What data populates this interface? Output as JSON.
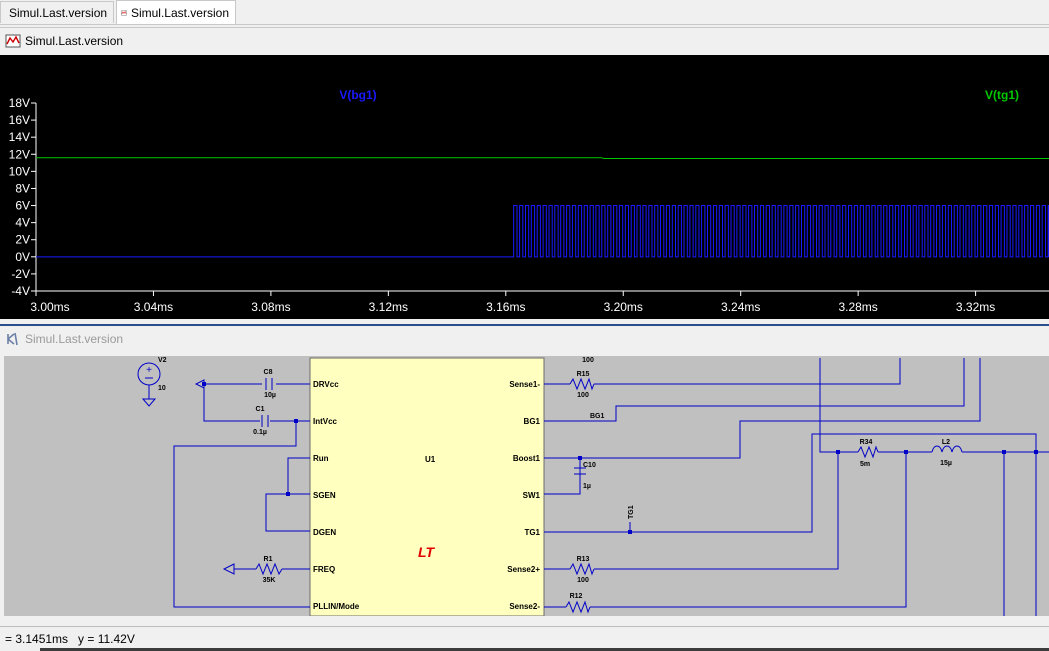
{
  "tabs": [
    {
      "label": "Simul.Last.version",
      "icon": "schematic-icon",
      "active": false
    },
    {
      "label": "Simul.Last.version",
      "icon": "waveform-icon",
      "active": true
    }
  ],
  "wave_window": {
    "title": "Simul.Last.version",
    "icon": "waveform-icon"
  },
  "schematic_window": {
    "title": "Simul.Last.version",
    "icon": "schematic-icon"
  },
  "chart_data": {
    "type": "line",
    "title": "",
    "xlabel": "",
    "ylabel": "",
    "xlim": [
      3.0,
      3.345
    ],
    "ylim": [
      -4,
      18
    ],
    "x_ticks": [
      "3.00ms",
      "3.04ms",
      "3.08ms",
      "3.12ms",
      "3.16ms",
      "3.20ms",
      "3.24ms",
      "3.28ms",
      "3.32ms"
    ],
    "x_tick_values": [
      3.0,
      3.04,
      3.08,
      3.12,
      3.16,
      3.2,
      3.24,
      3.28,
      3.32
    ],
    "y_ticks": [
      "18V",
      "16V",
      "14V",
      "12V",
      "10V",
      "8V",
      "6V",
      "4V",
      "2V",
      "0V",
      "-2V",
      "-4V"
    ],
    "y_tick_values": [
      18,
      16,
      14,
      12,
      10,
      8,
      6,
      4,
      2,
      0,
      -2,
      -4
    ],
    "legend_placement": "top",
    "series": [
      {
        "name": "V(bg1)",
        "color": "#1a1aff",
        "low": 0,
        "high": 6,
        "switch_start": 3.1627,
        "period": 0.002,
        "duty": 0.55
      },
      {
        "name": "V(tg1)",
        "color": "#00c800",
        "x": [
          3.0,
          3.1925,
          3.1935,
          3.345
        ],
        "values": [
          11.6,
          11.6,
          11.5,
          11.5
        ]
      }
    ],
    "colors": {
      "background": "#000000",
      "axis": "#ffffff"
    }
  },
  "schematic": {
    "source": {
      "name": "V2",
      "value": "10"
    },
    "ic": {
      "name": "U1",
      "logo": "LT",
      "left_pins": [
        "DRVcc",
        "IntVcc",
        "Run",
        "SGEN",
        "DGEN",
        "FREQ",
        "PLLIN/Mode"
      ],
      "right_pins": [
        "Sense1-",
        "BG1",
        "Boost1",
        "SW1",
        "TG1",
        "Sense2+",
        "Sense2-"
      ]
    },
    "components": [
      {
        "name": "C8",
        "value": "10µ"
      },
      {
        "name": "C1",
        "value": "0.1µ"
      },
      {
        "name": "R1",
        "value": "35K"
      },
      {
        "name": "R15",
        "value": "100"
      },
      {
        "name": "C10",
        "value": "1µ"
      },
      {
        "name": "R13",
        "value": "100"
      },
      {
        "name": "R12",
        "value": ""
      },
      {
        "name": "R34",
        "value": "5m"
      },
      {
        "name": "L2",
        "value": "15µ"
      }
    ],
    "net_labels": [
      "BG1",
      "TG1"
    ],
    "top_cut_label": "100"
  },
  "status": {
    "text": "= 3.1451ms   y = 11.42V"
  }
}
